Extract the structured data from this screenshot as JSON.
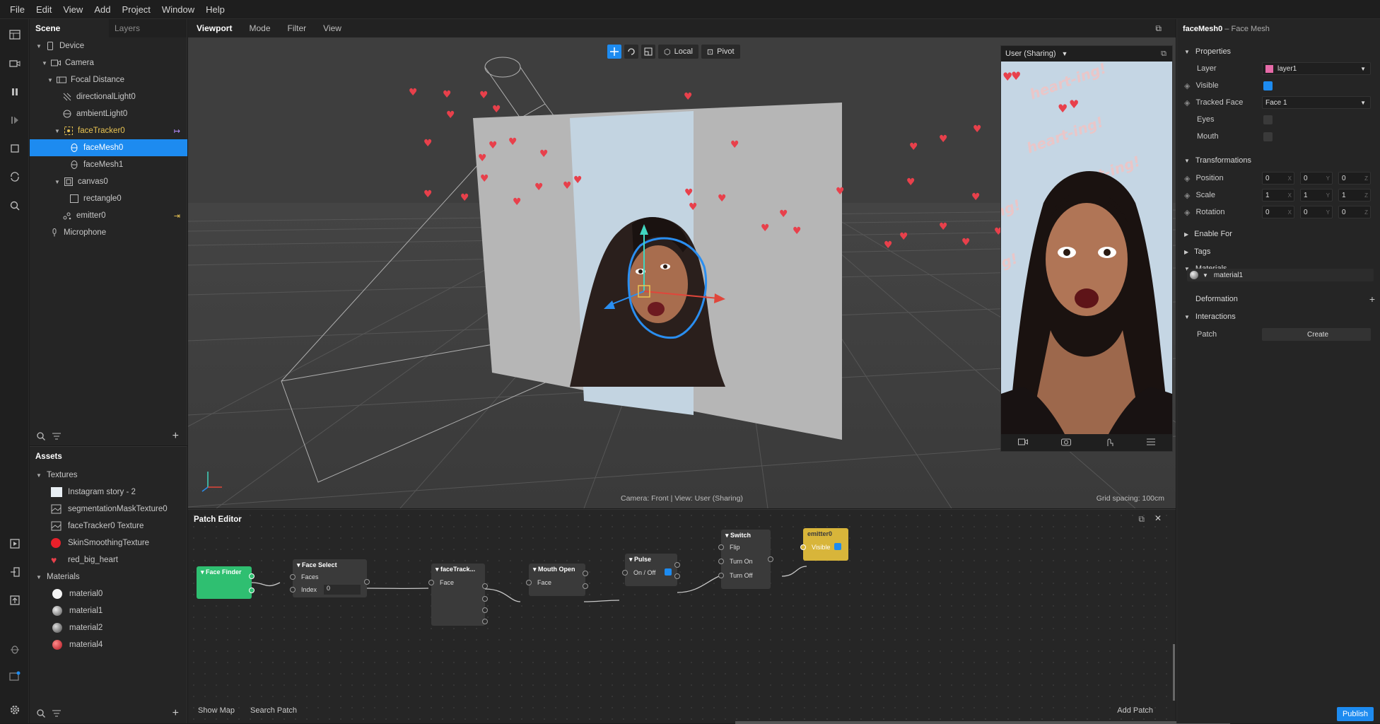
{
  "menu": [
    "File",
    "Edit",
    "View",
    "Add",
    "Project",
    "Window",
    "Help"
  ],
  "scene": {
    "tab_scene": "Scene",
    "tab_layers": "Layers",
    "tree": [
      "Device",
      "Camera",
      "Focal Distance",
      "directionalLight0",
      "ambientLight0",
      "faceTracker0",
      "faceMesh0",
      "faceMesh1",
      "canvas0",
      "rectangle0",
      "emitter0",
      "Microphone"
    ]
  },
  "assets": {
    "title": "Assets",
    "textures_label": "Textures",
    "textures": [
      "Instagram story - 2",
      "segmentationMaskTexture0",
      "faceTracker0 Texture",
      "SkinSmoothingTexture",
      "red_big_heart"
    ],
    "materials_label": "Materials",
    "materials": [
      "material0",
      "material1",
      "material2",
      "material4"
    ]
  },
  "viewport": {
    "tabs": [
      "Viewport",
      "Mode",
      "Filter",
      "View"
    ],
    "local_label": "Local",
    "pivot_label": "Pivot",
    "camera_status": "Camera: Front | View: User (Sharing)",
    "grid_spacing": "Grid spacing: 100cm",
    "preview_title": "User (Sharing)",
    "watermark_text": "heart-ing!"
  },
  "patch_editor": {
    "title": "Patch Editor",
    "show_map": "Show Map",
    "search_patch": "Search Patch",
    "add_patch": "Add Patch",
    "nodes": {
      "face_finder": "Face Finder",
      "face_select": "Face Select",
      "faces": "Faces",
      "index": "Index",
      "index_value": "0",
      "face_tracker": "faceTrack...",
      "face": "Face",
      "mouth_open": "Mouth Open",
      "mouth_face": "Face",
      "pulse": "Pulse",
      "on_off": "On / Off",
      "switch": "Switch",
      "flip": "Flip",
      "turn_on": "Turn On",
      "turn_off": "Turn Off",
      "emitter": "emitter0",
      "visible": "Visible"
    }
  },
  "properties": {
    "object_name": "faceMesh0",
    "object_type": "Face Mesh",
    "properties_section": "Properties",
    "layer_label": "Layer",
    "layer_value": "layer1",
    "visible_label": "Visible",
    "tracked_face_label": "Tracked Face",
    "tracked_face_value": "Face 1",
    "eyes_label": "Eyes",
    "mouth_label": "Mouth",
    "transformations_section": "Transformations",
    "position_label": "Position",
    "position": [
      "0",
      "0",
      "0"
    ],
    "scale_label": "Scale",
    "scale": [
      "1",
      "1",
      "1"
    ],
    "rotation_label": "Rotation",
    "rotation": [
      "0",
      "0",
      "0"
    ],
    "enable_for": "Enable For",
    "tags": "Tags",
    "materials_section": "Materials",
    "material_value": "material1",
    "deformation": "Deformation",
    "interactions_section": "Interactions",
    "patch_label": "Patch",
    "create_label": "Create",
    "publish": "Publish"
  },
  "colors": {
    "accent": "#1d8bf0",
    "tracker": "#e9c453",
    "face_finder": "#2fbf71",
    "emitter_node": "#d8b53a",
    "heart": "#e8404b"
  }
}
